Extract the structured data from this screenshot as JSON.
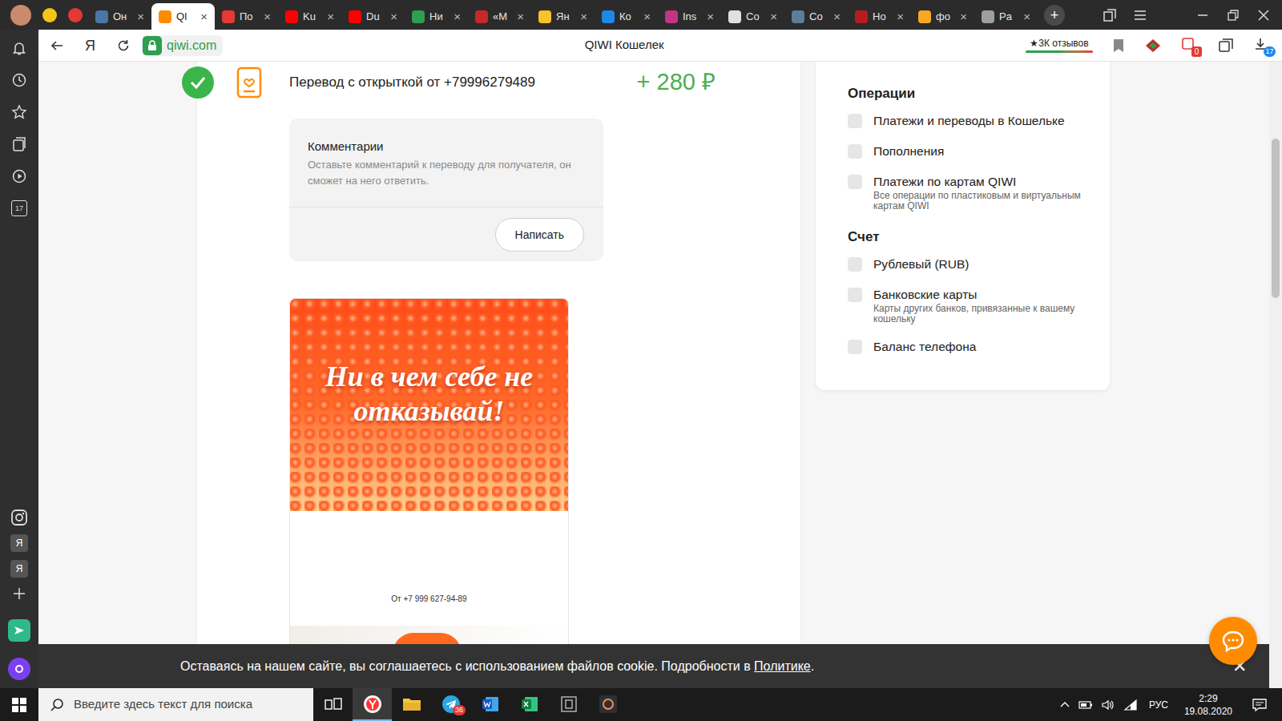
{
  "browser": {
    "pinned_tabs": [
      {
        "color": "#c98b6b",
        "selected": false
      },
      {
        "color": "#f5c518",
        "selected": false
      },
      {
        "color": "#e53935",
        "selected": false
      }
    ],
    "tabs": [
      {
        "label": "Он",
        "close": "×",
        "color": "#4a76a8",
        "selected": false
      },
      {
        "label": "QI",
        "close": "×",
        "color": "#ff8c00",
        "selected": true
      },
      {
        "label": "По",
        "close": "×",
        "color": "#e53935",
        "selected": false
      },
      {
        "label": "Ku",
        "close": "×",
        "color": "#ff0000",
        "selected": false
      },
      {
        "label": "Du",
        "close": "×",
        "color": "#ff0000",
        "selected": false
      },
      {
        "label": "Ни",
        "close": "×",
        "color": "#2e9e4f",
        "selected": false
      },
      {
        "label": "«М",
        "close": "×",
        "color": "#c62828",
        "selected": false
      },
      {
        "label": "Ян",
        "close": "×",
        "color": "#fbc02d",
        "selected": false
      },
      {
        "label": "Ко",
        "close": "×",
        "color": "#1e88e5",
        "selected": false
      },
      {
        "label": "Ins",
        "close": "×",
        "color": "#c13584",
        "selected": false
      },
      {
        "label": "Co",
        "close": "×",
        "color": "#e0e0e0",
        "selected": false
      },
      {
        "label": "Co",
        "close": "×",
        "color": "#5c7e99",
        "selected": false
      },
      {
        "label": "Но",
        "close": "×",
        "color": "#b71c1c",
        "selected": false
      },
      {
        "label": "фо",
        "close": "×",
        "color": "#f9a825",
        "selected": false
      },
      {
        "label": "Pa",
        "close": "×",
        "color": "#9e9e9e",
        "selected": false
      }
    ],
    "new_tab": "+",
    "address": {
      "logo": "Я",
      "url": "qiwi.com",
      "title": "QIWI Кошелек",
      "reviews": "★3К отзывов"
    },
    "toolbar_badges": {
      "extension": "0",
      "downloads": "17"
    }
  },
  "sidebar": {
    "calendar": "17",
    "apps": [
      "Я",
      "Я"
    ]
  },
  "transaction": {
    "title": "Перевод с открыткой от +79996279489",
    "amount": "+ 280 ₽",
    "done": true
  },
  "comments": {
    "title": "Комментарии",
    "hint": "Оставьте комментарий к переводу для получателя, он сможет на него ответить.",
    "button": "Написать"
  },
  "postcard": {
    "headline": "Ни в чем себе не отказывай!",
    "from": "От +7 999 627-94-89"
  },
  "filters": [
    {
      "title": "Операции",
      "items": [
        {
          "label": "Платежи и переводы в Кошельке",
          "checked": false
        },
        {
          "label": "Пополнения",
          "checked": false
        },
        {
          "label": "Платежи по картам QIWI",
          "sub": "Все операции по пластиковым и виртуальным картам QIWI",
          "checked": false
        }
      ]
    },
    {
      "title": "Счет",
      "items": [
        {
          "label": "Рублевый (RUB)",
          "checked": false
        },
        {
          "label": "Банковские карты",
          "sub": "Карты других банков, привязанные к вашему кошельку",
          "checked": false
        },
        {
          "label": "Баланс телефона",
          "checked": false
        }
      ]
    }
  ],
  "cookie": {
    "text": "Оставаясь на нашем сайте, вы соглашаетесь с использованием файлов cookie. Подробности в ",
    "link": "Политике",
    "end": ".",
    "close": "✕"
  },
  "taskbar": {
    "search": "Введите здесь текст для поиска",
    "apps": [
      {
        "kind": "taskview",
        "selected": false
      },
      {
        "kind": "yandex",
        "selected": true
      },
      {
        "kind": "explorer",
        "selected": false
      },
      {
        "kind": "telegram",
        "selected": false,
        "badge": "36"
      },
      {
        "kind": "word",
        "selected": false
      },
      {
        "kind": "excel",
        "selected": false
      },
      {
        "kind": "bapp",
        "selected": false
      },
      {
        "kind": "fox",
        "selected": false
      }
    ],
    "lang": "РУС",
    "time": "2:29",
    "date": "19.08.2020"
  }
}
